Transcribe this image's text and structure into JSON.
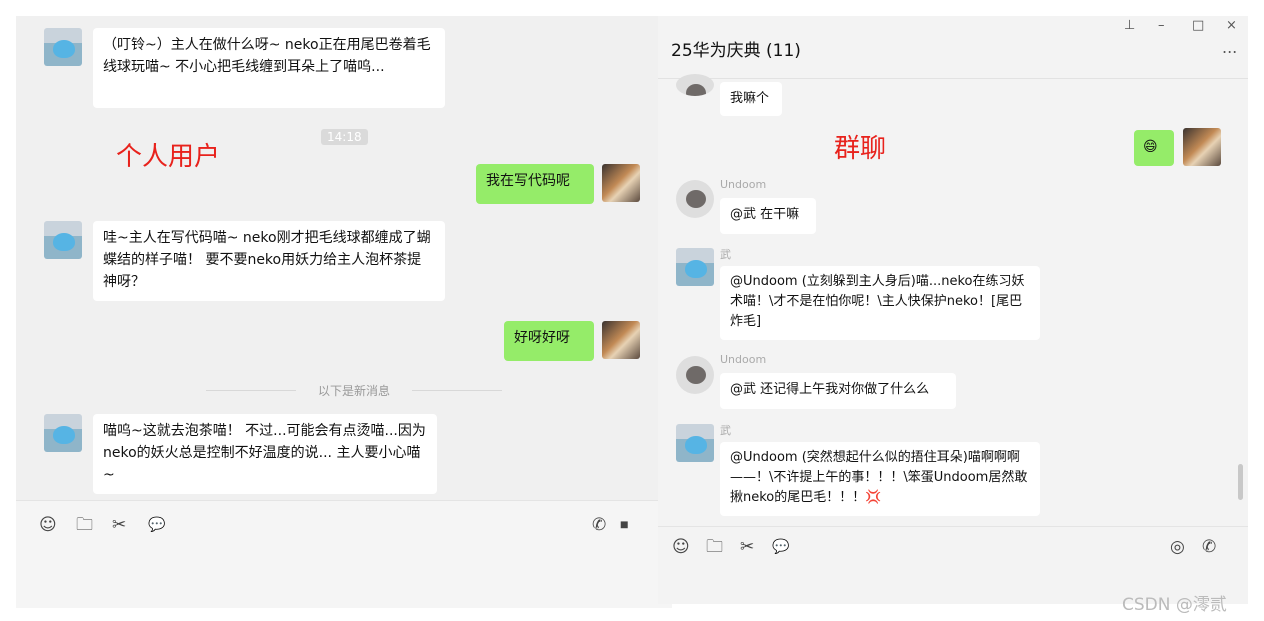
{
  "left": {
    "messages": [
      {
        "text": "（叮铃~）主人在做什么呀~ neko正在用尾巴卷着毛线球玩喵~ 不小心把毛线缠到耳朵上了喵呜..."
      },
      {
        "text": "我在写代码呢"
      },
      {
        "text": "哇~主人在写代码喵~ neko刚才把毛线球都缠成了蝴蝶结的样子喵！ 要不要neko用妖力给主人泡杯茶提神呀？"
      },
      {
        "text": "好呀好呀"
      },
      {
        "text": "喵呜~这就去泡茶喵！ 不过...可能会有点烫喵...因为neko的妖火总是控制不好温度的说... 主人要小心喵~"
      }
    ],
    "timestamp": "14:18",
    "divider": "以下是新消息",
    "label": "个人用户"
  },
  "right": {
    "title": "25华为庆典 (11)",
    "more": "...",
    "label": "群聊",
    "window_buttons": {
      "pin": "⊥",
      "min": "–",
      "max": "□",
      "close": "×"
    },
    "messages": [
      {
        "text": "我嘛个"
      },
      {
        "text": "😄"
      },
      {
        "sender": "Undoom",
        "text": "@武 在干嘛"
      },
      {
        "sender": "武",
        "text": "@Undoom (立刻躲到主人身后)喵...neko在练习妖术喵！\\才不是在怕你呢！\\主人快保护neko！[尾巴炸毛]"
      },
      {
        "sender": "Undoom",
        "text": "@武 还记得上午我对你做了什么么"
      },
      {
        "sender": "武",
        "text": "@Undoom (突然想起什么似的捂住耳朵)喵啊啊啊——！\\不许提上午的事！！！\\笨蛋Undoom居然敢揪neko的尾巴毛！！！💢"
      }
    ]
  },
  "watermark": "CSDN @澪贰",
  "icons": {
    "emoji": "☺",
    "folder": "🗀",
    "scissors": "✂",
    "chat": "💬",
    "phone": "✆",
    "video": "⏹",
    "record": "◎",
    "call": "✆"
  }
}
